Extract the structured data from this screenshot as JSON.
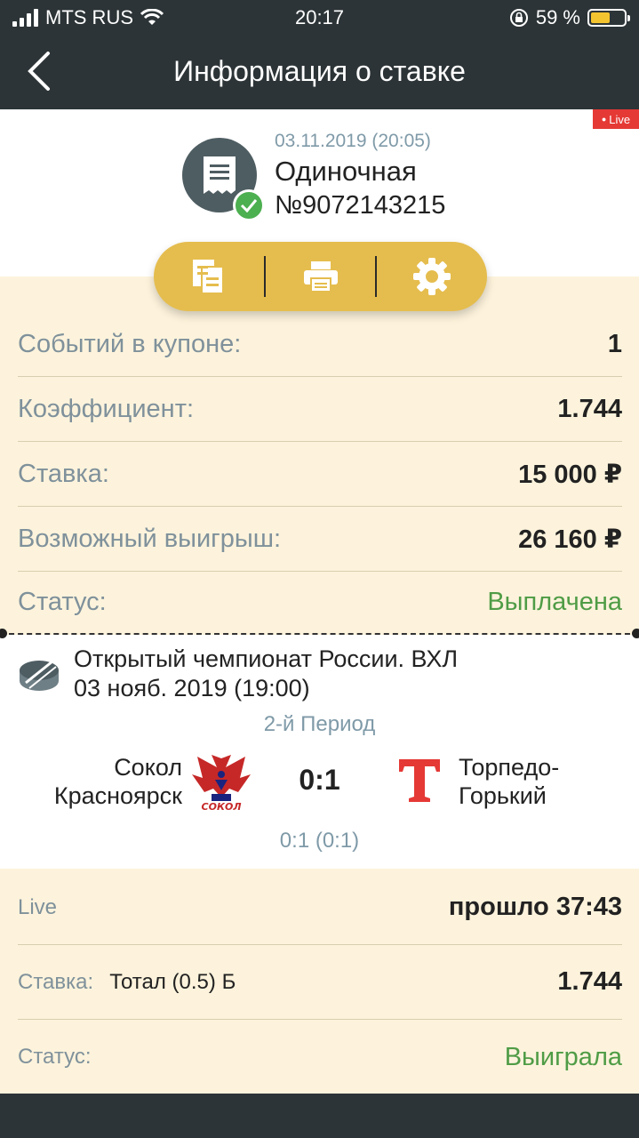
{
  "status_bar": {
    "carrier": "MTS RUS",
    "time": "20:17",
    "battery": "59 %",
    "battery_level": 0.59
  },
  "header": {
    "title": "Информация о ставке"
  },
  "bet": {
    "live_badge": "Live",
    "date": "03.11.2019 (20:05)",
    "type": "Одиночная",
    "number": "№9072143215"
  },
  "summary": [
    {
      "label": "Событий в купоне:",
      "value": "1"
    },
    {
      "label": "Коэффициент:",
      "value": "1.744"
    },
    {
      "label": "Ставка:",
      "value": "15 000 ₽"
    },
    {
      "label": "Возможный выигрыш:",
      "value": "26 160 ₽"
    },
    {
      "label": "Статус:",
      "value": "Выплачена"
    }
  ],
  "match": {
    "league": "Открытый чемпионат России. ВХЛ",
    "date": "03 нояб. 2019 (19:00)",
    "period": "2-й Период",
    "home_line1": "Сокол",
    "home_line2": "Красноярск",
    "home_logo_text": "СОКОЛ",
    "away_line1": "Торпедо-",
    "away_line2": "Горький",
    "score": "0:1",
    "subscore": "0:1 (0:1)"
  },
  "details": {
    "live_label": "Live",
    "live_value": "прошло 37:43",
    "stake_label": "Ставка:",
    "stake_selection": "Тотал (0.5) Б",
    "stake_value": "1.744",
    "status_label": "Статус:",
    "status_value": "Выиграла"
  },
  "colors": {
    "header_bg": "#2c3437",
    "cream_bg": "#fdf3dc",
    "accent_gold": "#e5bd4e",
    "status_green": "#4f9c46",
    "live_red": "#e53935"
  },
  "icons": [
    "back-chevron-icon",
    "receipt-icon",
    "check-icon",
    "copy-document-icon",
    "printer-icon",
    "gear-icon",
    "hockey-puck-icon"
  ]
}
